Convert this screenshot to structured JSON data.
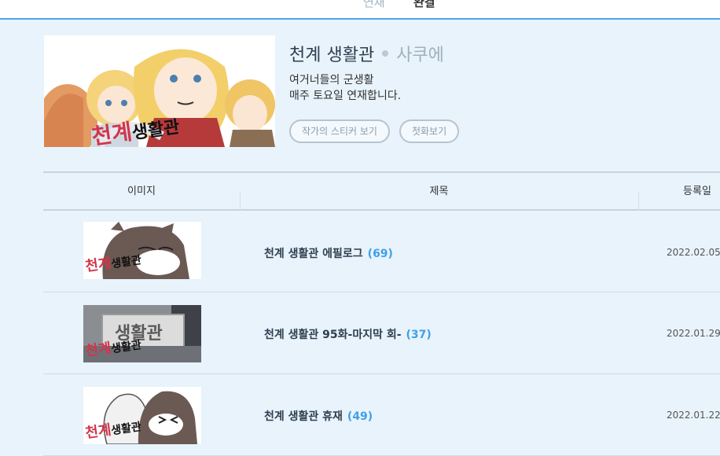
{
  "nav": {
    "serial_tab": "연재",
    "complete_tab": "완결"
  },
  "comic": {
    "title": "천계 생활관",
    "author": "사쿠에",
    "description_line1": "여거너들의 군생활",
    "description_line2": "매주 토요일 연재합니다.",
    "logo_text": "천계생활관",
    "sticker_button": "작가의 스티커 보기",
    "first_button": "첫화보기"
  },
  "table": {
    "headers": {
      "image": "이미지",
      "title": "제목",
      "date": "등록일"
    },
    "rows": [
      {
        "title": "천계 생활관 에필로그",
        "count": "(69)",
        "date": "2022.02.05"
      },
      {
        "title": "천계 생활관 95화-마지막 회-",
        "count": "(37)",
        "date": "2022.01.29"
      },
      {
        "title": "천계 생활관 휴재",
        "count": "(49)",
        "date": "2022.01.22"
      }
    ]
  },
  "thumb_logo": {
    "red": "천계",
    "black": "생활관"
  },
  "thumb_banner": "생활관"
}
